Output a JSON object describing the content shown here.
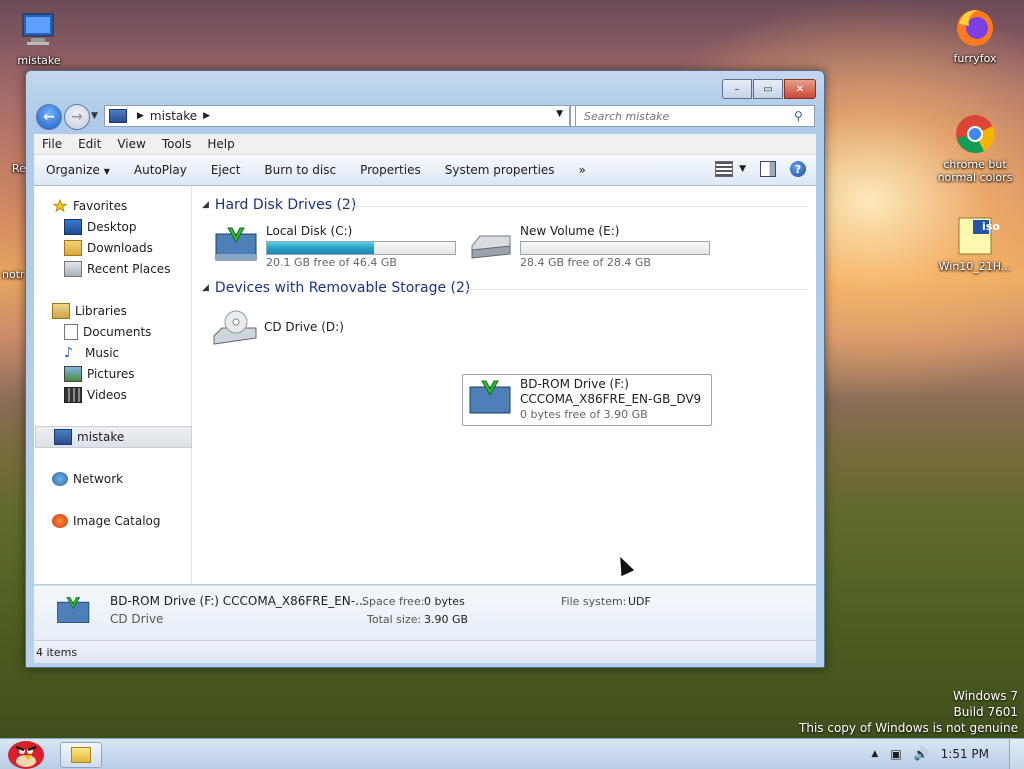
{
  "desktop": {
    "icons": [
      {
        "label": "mistake"
      },
      {
        "label": "Re"
      },
      {
        "label": "notr"
      },
      {
        "label": "furryfox"
      },
      {
        "label": "chrome but normal colors"
      },
      {
        "label": "Win10_21H..."
      }
    ],
    "iso_text": "iso"
  },
  "window": {
    "buttons": {
      "minimize": "–",
      "maximize": "▭",
      "close": "✕"
    },
    "address": {
      "location": "mistake"
    },
    "search": {
      "placeholder": "Search mistake"
    },
    "menu": [
      "File",
      "Edit",
      "View",
      "Tools",
      "Help"
    ],
    "commands": [
      "Organize",
      "AutoPlay",
      "Eject",
      "Burn to disc",
      "Properties",
      "System properties",
      "»"
    ],
    "nav": {
      "favorites": "Favorites",
      "favorites_items": [
        "Desktop",
        "Downloads",
        "Recent Places"
      ],
      "libraries": "Libraries",
      "libraries_items": [
        "Documents",
        "Music",
        "Pictures",
        "Videos"
      ],
      "computer": "mistake",
      "network": "Network",
      "catalog": "Image Catalog"
    },
    "groups": {
      "hdd": "Hard Disk Drives (2)",
      "removable": "Devices with Removable Storage (2)"
    },
    "drives": {
      "c": {
        "name": "Local Disk (C:)",
        "free": "20.1 GB free of 46.4 GB",
        "used_fraction": 0.567
      },
      "e": {
        "name": "New Volume (E:)",
        "free": "28.4 GB free of 28.4 GB",
        "used_fraction": 0.0
      },
      "d": {
        "name": "CD Drive (D:)"
      },
      "f": {
        "name": "BD-ROM Drive (F:)",
        "label": "CCCOMA_X86FRE_EN-GB_DV9",
        "free": "0 bytes free of 3.90 GB"
      }
    },
    "details": {
      "title": "BD-ROM Drive (F:) CCCOMA_X86FRE_EN-...",
      "type": "CD Drive",
      "space_free_k": "Space free:",
      "space_free_v": "0 bytes",
      "total_k": "Total size:",
      "total_v": "3.90 GB",
      "fs_k": "File system:",
      "fs_v": "UDF"
    },
    "status": "4 items"
  },
  "watermark": {
    "line1": "Windows 7",
    "line2": "Build 7601",
    "line3": "This copy of Windows is not genuine"
  },
  "taskbar": {
    "time": "1:51 PM"
  }
}
